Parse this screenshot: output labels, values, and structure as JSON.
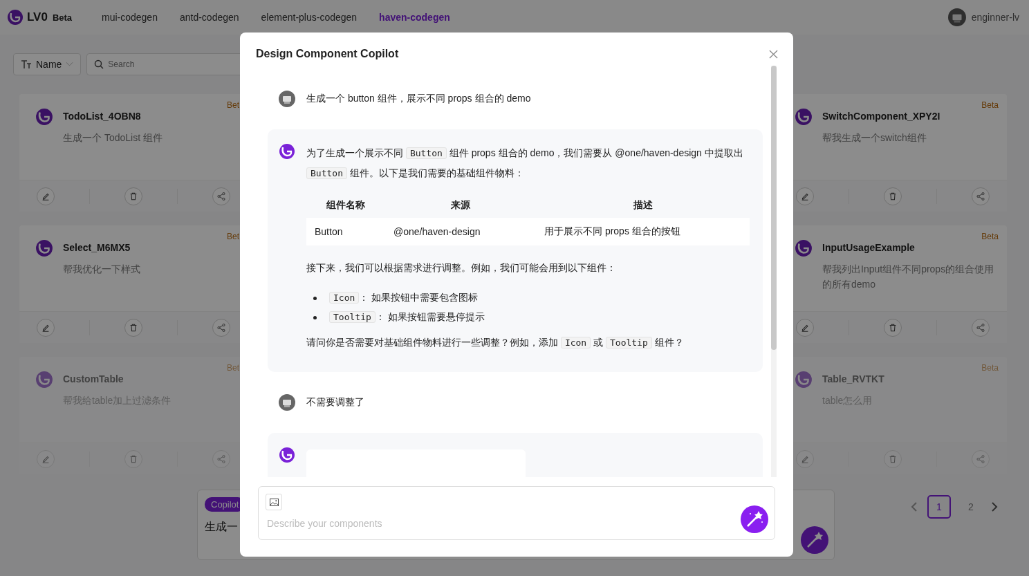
{
  "header": {
    "brand": "LV0",
    "badge": "Beta",
    "nav": [
      {
        "label": "mui-codegen",
        "selected": false
      },
      {
        "label": "antd-codegen",
        "selected": false
      },
      {
        "label": "element-plus-codegen",
        "selected": false
      },
      {
        "label": "haven-codegen",
        "selected": true
      }
    ],
    "user": "enginner-lv"
  },
  "filters": {
    "field": "Name",
    "search_placeholder": "Search"
  },
  "card_rows": [
    {
      "cards": [
        {
          "title": "TodoList_4OBN8",
          "description": "生成一个 TodoList 组件",
          "tag": "Bet"
        },
        {
          "title": "SwitchComponent_XPY2I",
          "description": "帮我生成一个switch组件",
          "tag": "Beta"
        }
      ]
    },
    {
      "cards": [
        {
          "title": "Select_M6MX5",
          "description": "帮我优化一下样式",
          "tag": "Bet"
        },
        {
          "title": "InputUsageExample",
          "description": "帮我列出Input组件不同props的组合使用的所有demo",
          "tag": "Beta"
        }
      ]
    },
    {
      "cards": [
        {
          "title": "CustomTable",
          "description": "帮我给table加上过滤条件",
          "tag": "Bet"
        },
        {
          "title": "Table_RVTKT",
          "description": "table怎么用",
          "tag": "Beta"
        }
      ]
    }
  ],
  "composer_bar": {
    "tag": "Copilot",
    "text": "生成一"
  },
  "pagination": [
    {
      "label": "1",
      "selected": true
    },
    {
      "label": "2",
      "selected": false
    }
  ],
  "dialog": {
    "title": "Design Component Copilot",
    "messages": [
      {
        "kind": "user",
        "text": "生成一个 button 组件，展示不同 props 组合的 demo"
      },
      {
        "kind": "assistant",
        "blocks": [
          {
            "kind": "paragraph",
            "segments": [
              {
                "kind": "text",
                "text": "为了生成一个展示不同 "
              },
              {
                "kind": "code",
                "text": "Button"
              },
              {
                "kind": "text",
                "text": " 组件 props 组合的 demo，我们需要从 @one/haven-design 中提取出 "
              },
              {
                "kind": "code",
                "text": "Button"
              },
              {
                "kind": "text",
                "text": " 组件。以下是我们需要的基础组件物料："
              }
            ]
          },
          {
            "kind": "table",
            "columns": [
              "组件名称",
              "来源",
              "描述"
            ],
            "rows": [
              [
                "Button",
                "@one/haven-design",
                "用于展示不同 props 组合的按钮"
              ]
            ]
          },
          {
            "kind": "paragraph",
            "segments": [
              {
                "kind": "text",
                "text": "接下来，我们可以根据需求进行调整。例如，我们可能会用到以下组件："
              }
            ]
          },
          {
            "kind": "list",
            "items": [
              {
                "segments": [
                  {
                    "kind": "code",
                    "text": "Icon"
                  },
                  {
                    "kind": "text",
                    "text": "： 如果按钮中需要包含图标"
                  }
                ]
              },
              {
                "segments": [
                  {
                    "kind": "code",
                    "text": "Tooltip"
                  },
                  {
                    "kind": "text",
                    "text": "： 如果按钮需要悬停提示"
                  }
                ]
              }
            ]
          },
          {
            "kind": "paragraph",
            "segments": [
              {
                "kind": "text",
                "text": "请问你是否需要对基础组件物料进行一些调整？例如，添加 "
              },
              {
                "kind": "code",
                "text": "Icon"
              },
              {
                "kind": "text",
                "text": " 或 "
              },
              {
                "kind": "code",
                "text": "Tooltip"
              },
              {
                "kind": "text",
                "text": " 组件？"
              }
            ]
          }
        ]
      },
      {
        "kind": "user",
        "text": "不需要调整了"
      },
      {
        "kind": "pending"
      }
    ],
    "input": {
      "placeholder": "Describe your components"
    }
  }
}
